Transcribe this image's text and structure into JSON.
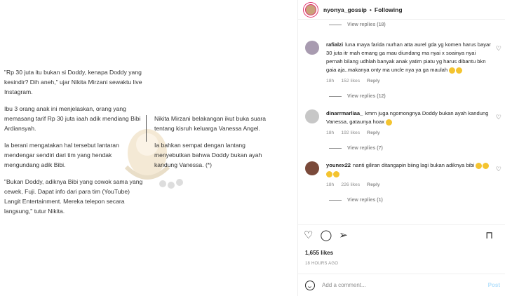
{
  "article": {
    "left_paragraphs": [
      "\"Rp 30 juta itu bukan si Doddy, kenapa Doddy yang kesindir? Dih aneh,\" ujar Nikita Mirzani sewaktu live Instagram.",
      "Ibu 3 orang anak ini menjelaskan, orang yang memasang tarif Rp 30 juta iaah adik mendiang Bibi Ardiansyah.",
      "Ia berani mengatakan hal tersebut lantaran mendengar sendiri dari tim yang hendak mengundang adik Bibi.",
      "\"Bukan Doddy, adiknya Bibi yang cowok sama yang cewek, Fuji. Dapat info dari para tim (YouTube) Langit Entertainment. Mereka telepon secara langsung,\" tutur Nikita."
    ],
    "right_paragraphs": [
      "Nikita Mirzani belakangan ikut buka suara tentang kisruh keluarga Vanessa Angel.",
      "Ia bahkan sempat dengan lantang menyebutkan bahwa Doddy bukan ayah kandung Vanessa. (*)"
    ]
  },
  "post": {
    "username": "nyonya_gossip",
    "separator": "•",
    "follow_status": "Following",
    "replies_top": "View replies (18)",
    "comments": [
      {
        "user": "rafialzi",
        "text": "luna maya farida nurhan atta aurel gda yg komen harus bayar 30 juta itr mah emang ga mau diundang ma nyai x soainya nyai pernah bilang udhlah banyak anak yatim piatu yg harus dibantu bkn gaia aja..makanya onty ma uncle nya ya ga maulah",
        "emoji_count": 2,
        "time": "18h",
        "likes": "152 likes",
        "reply": "Reply",
        "replies": "View replies (12)",
        "avatar_color": "#a89bb0"
      },
      {
        "user": "dinarrmarliaa_",
        "text": "kmrn juga ngomongnya Doddy bukan ayah kandung Vanessa, gataunya hoax",
        "emoji_count": 1,
        "time": "18h",
        "likes": "192 likes",
        "reply": "Reply",
        "replies": "View replies (7)",
        "avatar_color": "#c7c7c7"
      },
      {
        "user": "younex22",
        "text": "nanti giliran ditangapin biing lagi bukan adiknya bibi",
        "emoji_count": 4,
        "time": "18h",
        "likes": "226 likes",
        "reply": "Reply",
        "replies": "View replies (1)",
        "avatar_color": "#7a4a3a"
      }
    ],
    "likes": "1,655 likes",
    "timestamp": "18 HOURS AGO",
    "comment_placeholder": "Add a comment...",
    "post_label": "Post"
  },
  "icons": {
    "heart": "heart-icon",
    "comment": "comment-icon",
    "share": "share-icon",
    "bookmark": "bookmark-icon",
    "emoji": "emoji-icon"
  },
  "colors": {
    "accent": "#e1306c",
    "muted": "#8e8e8e",
    "post_button": "#b2dffc"
  }
}
